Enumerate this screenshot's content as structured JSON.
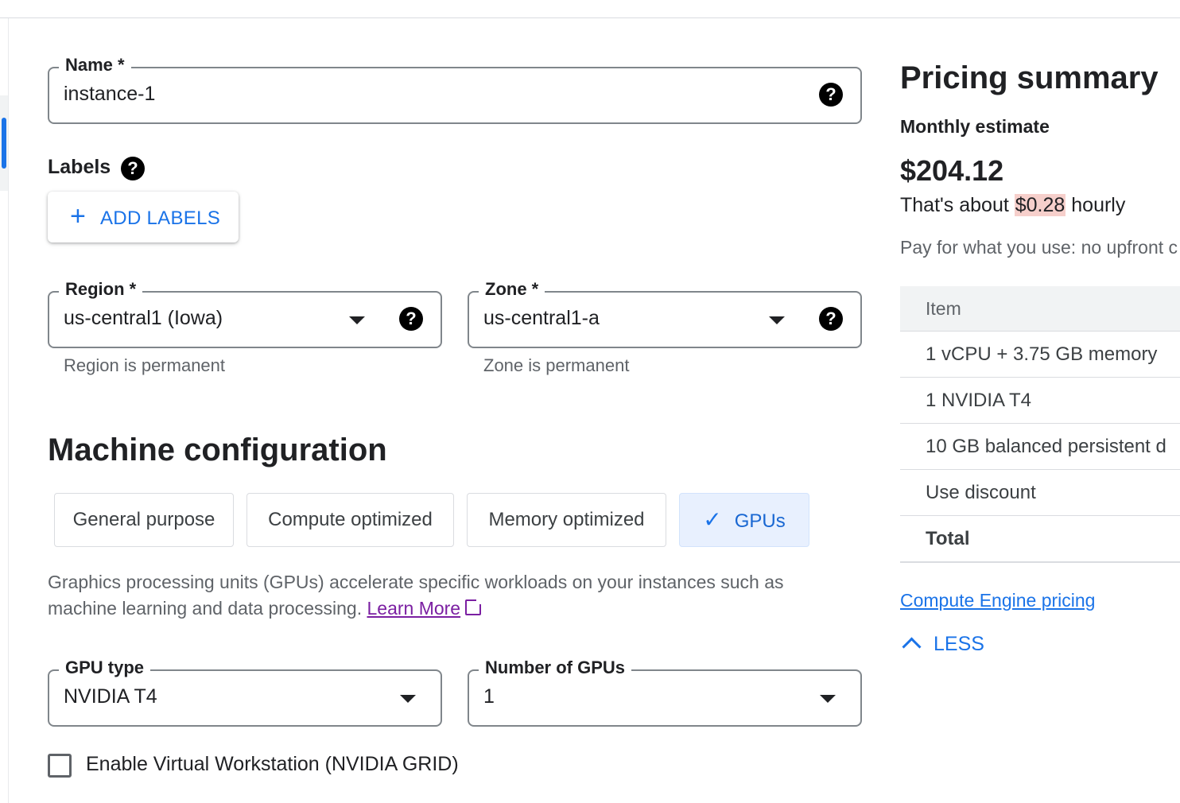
{
  "form": {
    "name": {
      "label": "Name *",
      "value": "instance-1",
      "help": "?"
    },
    "labels": {
      "title": "Labels",
      "help": "?",
      "add_button_icon": "+",
      "add_button": "ADD LABELS"
    },
    "region": {
      "label": "Region *",
      "value": "us-central1 (Iowa)",
      "hint": "Region is permanent",
      "help": "?"
    },
    "zone": {
      "label": "Zone *",
      "value": "us-central1-a",
      "hint": "Zone is permanent",
      "help": "?"
    }
  },
  "machine": {
    "title": "Machine configuration",
    "tabs": [
      {
        "label": "General purpose",
        "active": false
      },
      {
        "label": "Compute optimized",
        "active": false
      },
      {
        "label": "Memory optimized",
        "active": false
      },
      {
        "label": "GPUs",
        "active": true
      }
    ],
    "tab_check_icon": "✓",
    "description": "Graphics processing units (GPUs) accelerate specific workloads on your instances such as machine learning and data processing.",
    "learn_more": "Learn More",
    "gpu_type": {
      "label": "GPU type",
      "value": "NVIDIA T4"
    },
    "gpu_count": {
      "label": "Number of GPUs",
      "value": "1"
    },
    "virtual_workstation": {
      "label": "Enable Virtual Workstation (NVIDIA GRID)",
      "checked": false
    }
  },
  "pricing": {
    "title": "Pricing summary",
    "subtitle": "Monthly estimate",
    "price": "$204.12",
    "hourly_prefix": "That's about ",
    "hourly_value": "$0.28",
    "hourly_suffix": " hourly",
    "note": "Pay for what you use: no upfront c",
    "table": {
      "header": "Item",
      "rows": [
        "1 vCPU + 3.75 GB memory",
        "1 NVIDIA T4",
        "10 GB balanced persistent d",
        "Use discount"
      ],
      "total": "Total"
    },
    "link": "Compute Engine pricing",
    "less": "LESS"
  },
  "colors": {
    "accent": "#1a73e8",
    "link_visited": "#7b1fa2",
    "highlight": "#f6cfcb"
  }
}
